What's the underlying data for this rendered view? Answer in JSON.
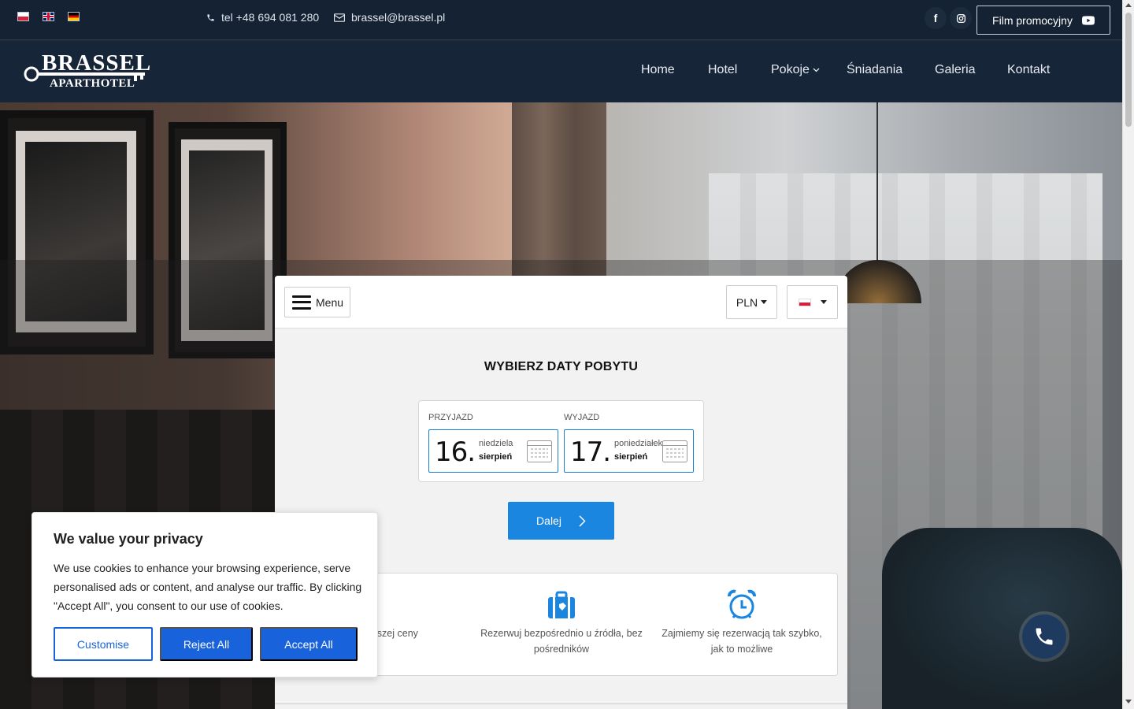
{
  "topbar": {
    "languages": [
      "pl",
      "en",
      "de"
    ],
    "phone": "tel +48 694 081 280",
    "email": "brassel@brassel.pl",
    "social": [
      "facebook-icon",
      "instagram-icon"
    ],
    "film_button": "Film promocyjny"
  },
  "brand": {
    "name": "BRASSEL",
    "subtitle": "APARTHOTEL"
  },
  "nav": {
    "items": [
      {
        "label": "Home"
      },
      {
        "label": "Hotel"
      },
      {
        "label": "Pokoje"
      },
      {
        "label": "Śniadania"
      },
      {
        "label": "Galeria"
      },
      {
        "label": "Kontakt"
      }
    ]
  },
  "booking": {
    "menu_label": "Menu",
    "currency": "PLN",
    "title": "WYBIERZ DATY POBYTU",
    "checkin": {
      "label": "PRZYJAZD",
      "day": "16.",
      "weekday": "niedziela",
      "month": "sierpień"
    },
    "checkout": {
      "label": "WYJAZD",
      "day": "17.",
      "weekday": "poniedziałek",
      "month": "sierpień"
    },
    "next_label": "Dalej",
    "benefits": [
      {
        "icon": "lowest-price-icon",
        "text": "ajniższej ceny"
      },
      {
        "icon": "luggage-icon",
        "text": "Rezerwuj bezpośrednio u źródła, bez pośredników"
      },
      {
        "icon": "alarm-clock-icon",
        "text": "Zajmiemy się rezerwacją tak szybko, jak to możliwe"
      }
    ]
  },
  "cookie": {
    "title": "We value your privacy",
    "text": "We use cookies to enhance your browsing experience, serve personalised ads or content, and analyse our traffic. By clicking \"Accept All\", you consent to our use of cookies.",
    "customise": "Customise",
    "reject": "Reject All",
    "accept": "Accept All"
  },
  "colors": {
    "topbar": "#152233",
    "navbar": "#172539",
    "accent": "#1a86e0",
    "cookie_button": "#1863dc",
    "fab": "#1e3a5f"
  }
}
